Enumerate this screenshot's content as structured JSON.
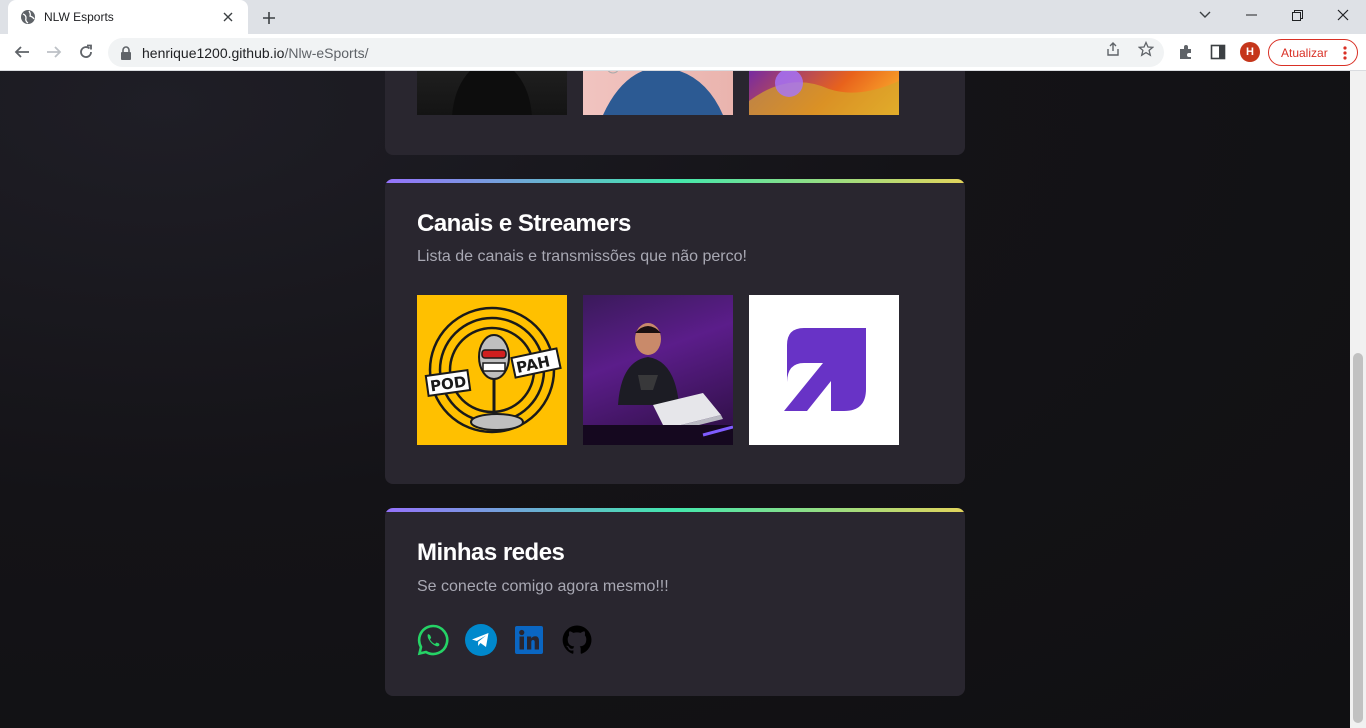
{
  "browser": {
    "tab_title": "NLW Esports",
    "url_host": "henrique1200.github.io",
    "url_path": "/Nlw-eSports/",
    "profile_initial": "H",
    "update_label": "Atualizar"
  },
  "sections": {
    "channels": {
      "title": "Canais e Streamers",
      "subtitle": "Lista de canais e transmissões que não perco!"
    },
    "networks": {
      "title": "Minhas redes",
      "subtitle": "Se conecte comigo agora mesmo!!!",
      "links": [
        "whatsapp-icon",
        "telegram-icon",
        "linkedin-icon",
        "github-icon"
      ]
    }
  },
  "images": {
    "podpah_left": "POD",
    "podpah_right": "PAH"
  },
  "colors": {
    "accent_gradient": [
      "#9572fc",
      "#43e7ad",
      "#e2d45c"
    ],
    "card_bg": "#29262f",
    "whatsapp": "#25d366",
    "telegram": "#0088cc",
    "linkedin": "#0a66c2"
  }
}
